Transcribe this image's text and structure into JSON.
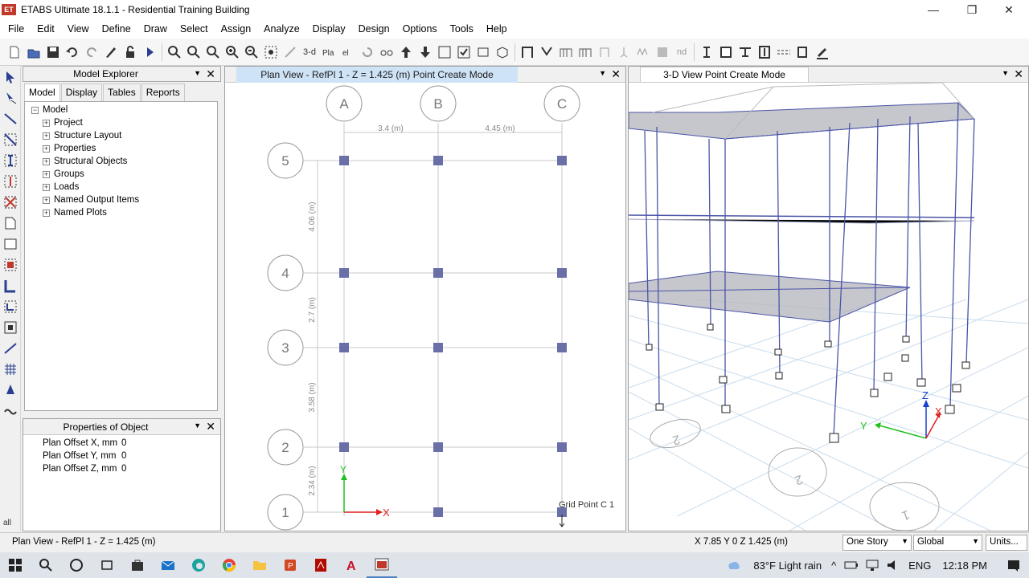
{
  "window": {
    "title": "ETABS Ultimate 18.1.1 - Residential Training Building",
    "logo_text": "ET",
    "minimize": "—",
    "maximize": "❐",
    "close": "✕"
  },
  "menu": [
    "File",
    "Edit",
    "View",
    "Define",
    "Draw",
    "Select",
    "Assign",
    "Analyze",
    "Display",
    "Design",
    "Options",
    "Tools",
    "Help"
  ],
  "toolbar": {
    "view3d_label": "3-d",
    "nd_label": "nd"
  },
  "model_explorer": {
    "title": "Model Explorer",
    "tabs": [
      "Model",
      "Display",
      "Tables",
      "Reports"
    ],
    "root": "Model",
    "items": [
      "Project",
      "Structure Layout",
      "Properties",
      "Structural Objects",
      "Groups",
      "Loads",
      "Named Output Items",
      "Named Plots"
    ]
  },
  "properties": {
    "title": "Properties of Object",
    "rows": [
      {
        "name": "Plan Offset X, mm",
        "value": "0"
      },
      {
        "name": "Plan Offset Y, mm",
        "value": "0"
      },
      {
        "name": "Plan Offset Z, mm",
        "value": "0"
      }
    ]
  },
  "plan_view": {
    "title": "Plan View - RefPl 1 - Z = 1.425 (m)  Point Create Mode",
    "grid_x": [
      "A",
      "B",
      "C"
    ],
    "grid_y": [
      "5",
      "4",
      "3",
      "2",
      "1"
    ],
    "dim_x": [
      "3.4 (m)",
      "4.45 (m)"
    ],
    "dim_y": [
      "4.06 (m)",
      "2.7 (m)",
      "3.58 (m)",
      "2.34 (m)"
    ],
    "axis_x": "X",
    "axis_y": "Y",
    "tooltip": "Grid Point  C  1"
  },
  "view3d": {
    "title": "3-D View  Point Create Mode",
    "axis_x": "X",
    "axis_y": "Y",
    "axis_z": "Z",
    "bubbles": [
      "2",
      "2",
      "1"
    ]
  },
  "status": {
    "left": "Plan View - RefPl 1 - Z = 1.425 (m)",
    "coords": "X 7.85  Y 0  Z 1.425 (m)",
    "story": "One Story",
    "coord_sys": "Global",
    "units": "Units...",
    "left_all": "all"
  },
  "taskbar": {
    "weather": "83°F  Light rain",
    "lang": "ENG",
    "time": "12:18 PM"
  },
  "colors": {
    "joint": "#6a6fa8",
    "frame": "#4a55a8",
    "slab": "#b8b8c0",
    "tab_active": "#cfe3f7",
    "axis_x": "#e02020",
    "axis_y": "#20c020",
    "axis_z": "#1a3fd0"
  }
}
